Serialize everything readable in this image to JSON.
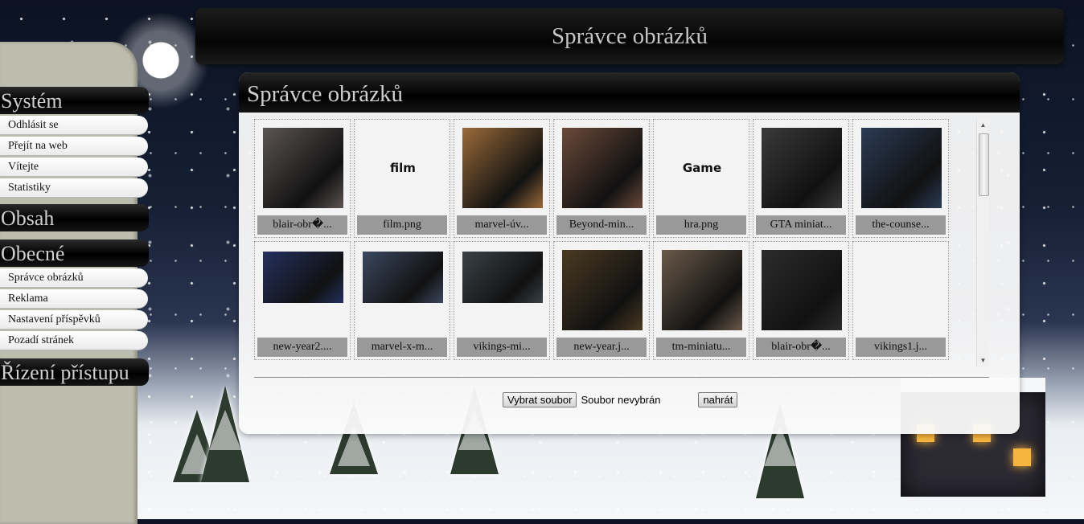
{
  "banner": {
    "title": "Správce obrázků"
  },
  "sidebar": {
    "sections": [
      {
        "title": "Systém",
        "items": [
          "Odhlásit se",
          "Přejít na web",
          "Vítejte",
          "Statistiky"
        ]
      },
      {
        "title": "Obsah",
        "items": []
      },
      {
        "title": "Obecné",
        "items": [
          "Správce obrázků",
          "Reklama",
          "Nastavení příspěvků",
          "Pozadí stránek"
        ]
      },
      {
        "title": "Řízení přístupu",
        "items": []
      }
    ]
  },
  "panel": {
    "title": "Správce obrázků"
  },
  "images": [
    {
      "caption": "blair-obr�...",
      "thumb": "photo",
      "color": "#5b5552"
    },
    {
      "caption": "film.png",
      "thumb": "text",
      "text": "film"
    },
    {
      "caption": "marvel-úv...",
      "thumb": "photo",
      "color": "#9b6a3a"
    },
    {
      "caption": "Beyond-min...",
      "thumb": "photo",
      "color": "#6b4a3a"
    },
    {
      "caption": "hra.png",
      "thumb": "text",
      "text": "Game"
    },
    {
      "caption": "GTA miniat...",
      "thumb": "photo",
      "color": "#3a3a3a"
    },
    {
      "caption": "the-counse...",
      "thumb": "photo",
      "color": "#2b3b55"
    },
    {
      "caption": "new-year2....",
      "thumb": "photo",
      "color": "#24305e"
    },
    {
      "caption": "marvel-x-m...",
      "thumb": "photo",
      "color": "#3c4860"
    },
    {
      "caption": "vikings-mi...",
      "thumb": "photo",
      "color": "#3a4248"
    },
    {
      "caption": "new-year.j...",
      "thumb": "photo",
      "color": "#4a3a22"
    },
    {
      "caption": "tm-miniatu...",
      "thumb": "photo",
      "color": "#6a5a4a"
    },
    {
      "caption": "blair-obr�...",
      "thumb": "photo",
      "color": "#2c2c2c"
    },
    {
      "caption": "vikings1.j...",
      "thumb": "none"
    }
  ],
  "upload": {
    "choose_label": "Vybrat soubor",
    "no_file": "Soubor nevybrán",
    "upload_label": "nahrát"
  },
  "colors": {
    "sidebar_bg": "#bdbdae",
    "header_bg": "#000000",
    "caption_bg": "#999999"
  }
}
